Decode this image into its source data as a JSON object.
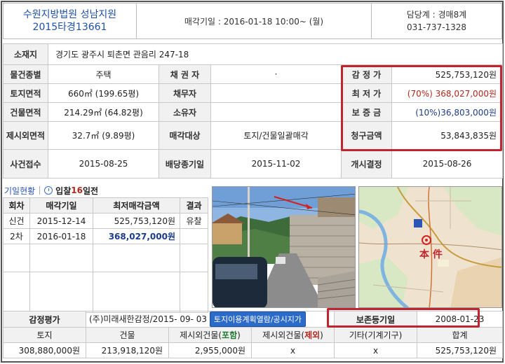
{
  "header": {
    "court": "수원지방법원 성남지원",
    "case_no": "2015타경13661",
    "sale_date": "매각기일 : 2016-01-18  10:00~ (월)",
    "dept": "담당계 : 경매8계",
    "phone": "031-737-1328"
  },
  "info": {
    "location_label": "소재지",
    "location": "경기도 광주시 퇴촌면 관음리 247-18",
    "type_label": "물건종별",
    "type": "주택",
    "creditor_label": "채 권 자",
    "creditor": "·",
    "appraisal_label": "감 정 가",
    "appraisal": "525,753,120원",
    "land_area_label": "토지면적",
    "land_area": "660㎡ (199.65평)",
    "debtor_label": "채무자",
    "debtor": "",
    "min_price_label": "최 저 가",
    "min_price": "(70%) 368,027,000원",
    "bldg_area_label": "건물면적",
    "bldg_area": "214.29㎡ (64.82평)",
    "owner_label": "소유자",
    "owner": "",
    "deposit_label": "보 증 금",
    "deposit": "(10%)36,803,000원",
    "excl_area_label": "제시외면적",
    "excl_area": "32.7㎡ (9.89평)",
    "target_label": "매각대상",
    "target": "토지/건물일괄매각",
    "claim_label": "청구금액",
    "claim": "53,843,835원",
    "filed_label": "사건접수",
    "filed": "2015-08-25",
    "dividend_label": "배당종기일",
    "dividend": "2015-11-02",
    "start_label": "개시결정",
    "start": "2015-08-26"
  },
  "history": {
    "title": "기일현황",
    "bid_prefix": "입찰",
    "bid_days": "16",
    "bid_suffix": "일전",
    "columns": [
      "회차",
      "매각기일",
      "최저매각금액",
      "결과"
    ],
    "rows": [
      {
        "round": "신건",
        "date": "2015-12-14",
        "amount": "525,753,120원",
        "result": "유찰"
      },
      {
        "round": "2차",
        "date": "2016-01-18",
        "amount": "368,027,000원",
        "result": ""
      }
    ]
  },
  "map_label": "本 件",
  "valuation": {
    "label": "감정평가",
    "appraiser": "(주)미래새한감정/2015- 09- 03",
    "land_use_button": "토지이용계획열람/공시지가",
    "reg_label": "보존등기일",
    "reg_date": "2008-01-23",
    "headers": [
      "토지",
      "건물",
      "제시외건물(",
      "포함",
      ")",
      "제시외건물(",
      "제외",
      ")",
      "기타(기계기구)",
      "합계"
    ],
    "land": "308,880,000원",
    "building": "213,918,120원",
    "excl_incl": "2,955,000원",
    "excl_excl": "x",
    "etc": "x",
    "total": "525,753,120원"
  },
  "colors": {
    "accent_blue": "#1f4fa8",
    "highlight_red": "#c0242f",
    "low_price": "#b0281c"
  }
}
